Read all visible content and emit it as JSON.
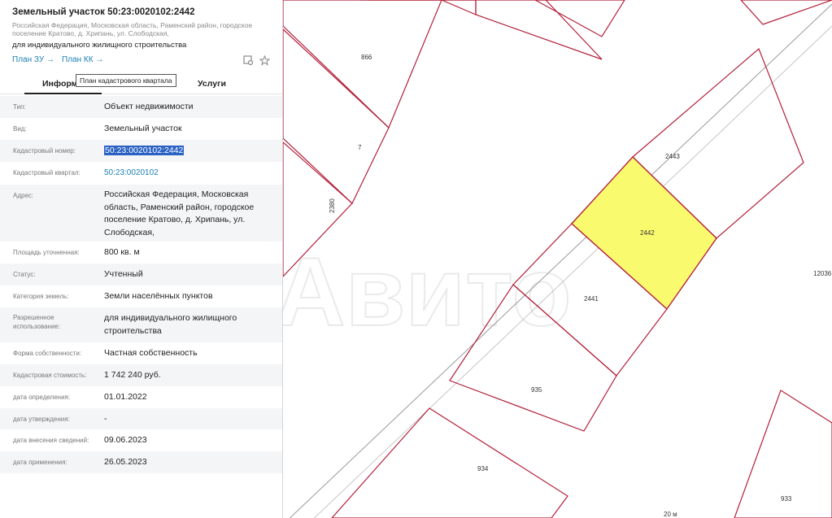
{
  "panel": {
    "title": "Земельный участок 50:23:0020102:2442",
    "address_line": "Российская Федерация, Московская область, Раменский район, городское поселение Кратово, д. Хрипань, ул. Слободская,",
    "purpose": "для индивидуального жилищного строительства",
    "plan_zu": "План ЗУ →",
    "plan_kk": "План КК →",
    "tooltip": "План кадастрового квартала",
    "tabs": [
      "Информ",
      "Услуги"
    ],
    "rows": [
      {
        "label": "Тип:",
        "value": "Объект недвижимости"
      },
      {
        "label": "Вид:",
        "value": "Земельный участок"
      },
      {
        "label": "Кадастровый номер:",
        "value": "50:23:0020102:2442"
      },
      {
        "label": "Кадастровый квартал:",
        "value": "50:23:0020102"
      },
      {
        "label": "Адрес:",
        "value": "Российская Федерация, Московская область, Раменский район, городское поселение Кратово, д. Хрипань, ул. Слободская,"
      },
      {
        "label": "Площадь уточненная:",
        "value": "800 кв. м"
      },
      {
        "label": "Статус:",
        "value": "Учтенный"
      },
      {
        "label": "Категория земель:",
        "value": "Земли населённых пунктов"
      },
      {
        "label": "Разрешенное использование:",
        "value": "для индивидуального жилищного строительства"
      },
      {
        "label": "Форма собственности:",
        "value": "Частная собственность"
      },
      {
        "label": "Кадастровая стоимость:",
        "value": "1 742 240 руб."
      },
      {
        "label": "дата определения:",
        "value": "01.01.2022"
      },
      {
        "label": "дата утверждения:",
        "value": "-"
      },
      {
        "label": "дата внесения сведений:",
        "value": "09.06.2023"
      },
      {
        "label": "дата применения:",
        "value": "26.05.2023"
      }
    ]
  },
  "map": {
    "parcel_labels": [
      "866",
      "7",
      "2380",
      "2443",
      "2442",
      "2441",
      "12036",
      "935",
      "934",
      "933"
    ],
    "highlight_color": "#fafa6e",
    "boundary_color": "#b3203a",
    "scale_label": "20 м"
  }
}
